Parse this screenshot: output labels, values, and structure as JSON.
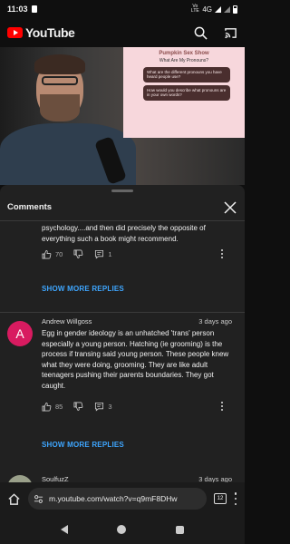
{
  "status_bar": {
    "time": "11:03",
    "network_label": "4G",
    "volte_label": "Vo LTE"
  },
  "header": {
    "logo_text": "YouTube",
    "search_icon": "search-icon",
    "cast_icon": "cast-icon"
  },
  "video_overlay": {
    "title": "Pumpkin Sex Show",
    "subtitle": "What Are My Pronouns?",
    "bubbles": [
      "What are the different pronouns you have heard people use?",
      "How would you describe what pronouns are in your own words?"
    ]
  },
  "comments_panel": {
    "title": "Comments",
    "comments": [
      {
        "text": "psychology....and then did precisely the opposite of everything such a book might recommend.",
        "likes": "70",
        "replies": "1",
        "show_more_label": "SHOW MORE REPLIES"
      },
      {
        "avatar_letter": "A",
        "avatar_color": "#d81b60",
        "author": "Andrew Willgoss",
        "time": "3 days ago",
        "text": "Egg in gender ideology is an unhatched 'trans' person especially a young person. Hatching (ie grooming) is the process if transing said young person. These people knew what they were doing, grooming. They are like adult teenagers pushing their parents boundaries. They got caught.",
        "likes": "85",
        "replies": "3",
        "show_more_label": "SHOW MORE REPLIES"
      },
      {
        "author": "SoulfuzZ",
        "time": "3 days ago"
      }
    ]
  },
  "browser": {
    "url": "m.youtube.com/watch?v=q9mF8DHw",
    "tab_count": "12"
  },
  "colors": {
    "accent_link": "#3ea6ff",
    "brand_red": "#ff0000",
    "sheet_bg": "#212121"
  }
}
